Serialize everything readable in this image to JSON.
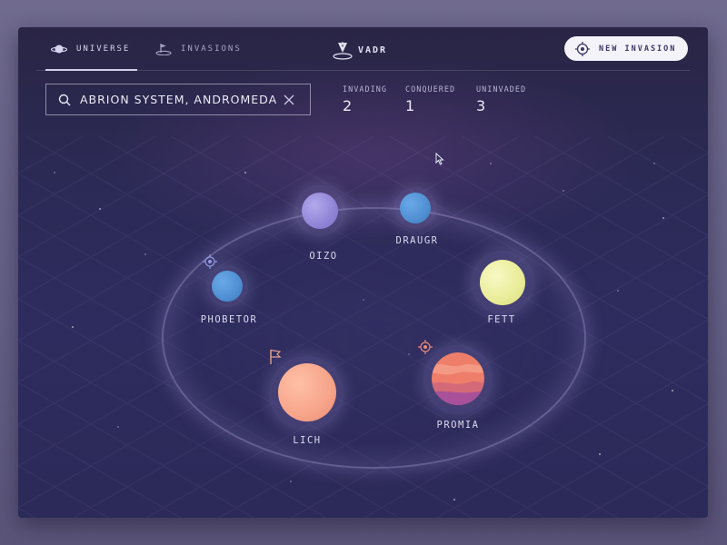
{
  "nav": {
    "tabs": [
      {
        "label": "UNIVERSE",
        "icon": "planet-icon",
        "active": true
      },
      {
        "label": "INVASIONS",
        "icon": "invasion-flag-icon",
        "active": false
      }
    ],
    "brand": "VADR",
    "new_invasion_label": "NEW INVASION"
  },
  "search": {
    "value": "ABRION SYSTEM, ANDROMEDA"
  },
  "stats": [
    {
      "label": "INVADING",
      "value": "2"
    },
    {
      "label": "CONQUERED",
      "value": "1"
    },
    {
      "label": "UNINVADED",
      "value": "3"
    }
  ],
  "planets": [
    {
      "name": "OIZO",
      "color": "#9a8fdc"
    },
    {
      "name": "DRAUGR",
      "color": "#4f8fd2"
    },
    {
      "name": "PHOBETOR",
      "color": "#4f8fd2"
    },
    {
      "name": "FETT",
      "color": "#eef0a2"
    },
    {
      "name": "LICH",
      "color": "#f6a48a"
    },
    {
      "name": "PROMIA",
      "color": "#ee7e6a"
    }
  ],
  "colors": {
    "background": "#2c2a58",
    "accent": "#f4f3fa",
    "target_marker": "#e88a78",
    "flag_marker": "#e0a090"
  }
}
